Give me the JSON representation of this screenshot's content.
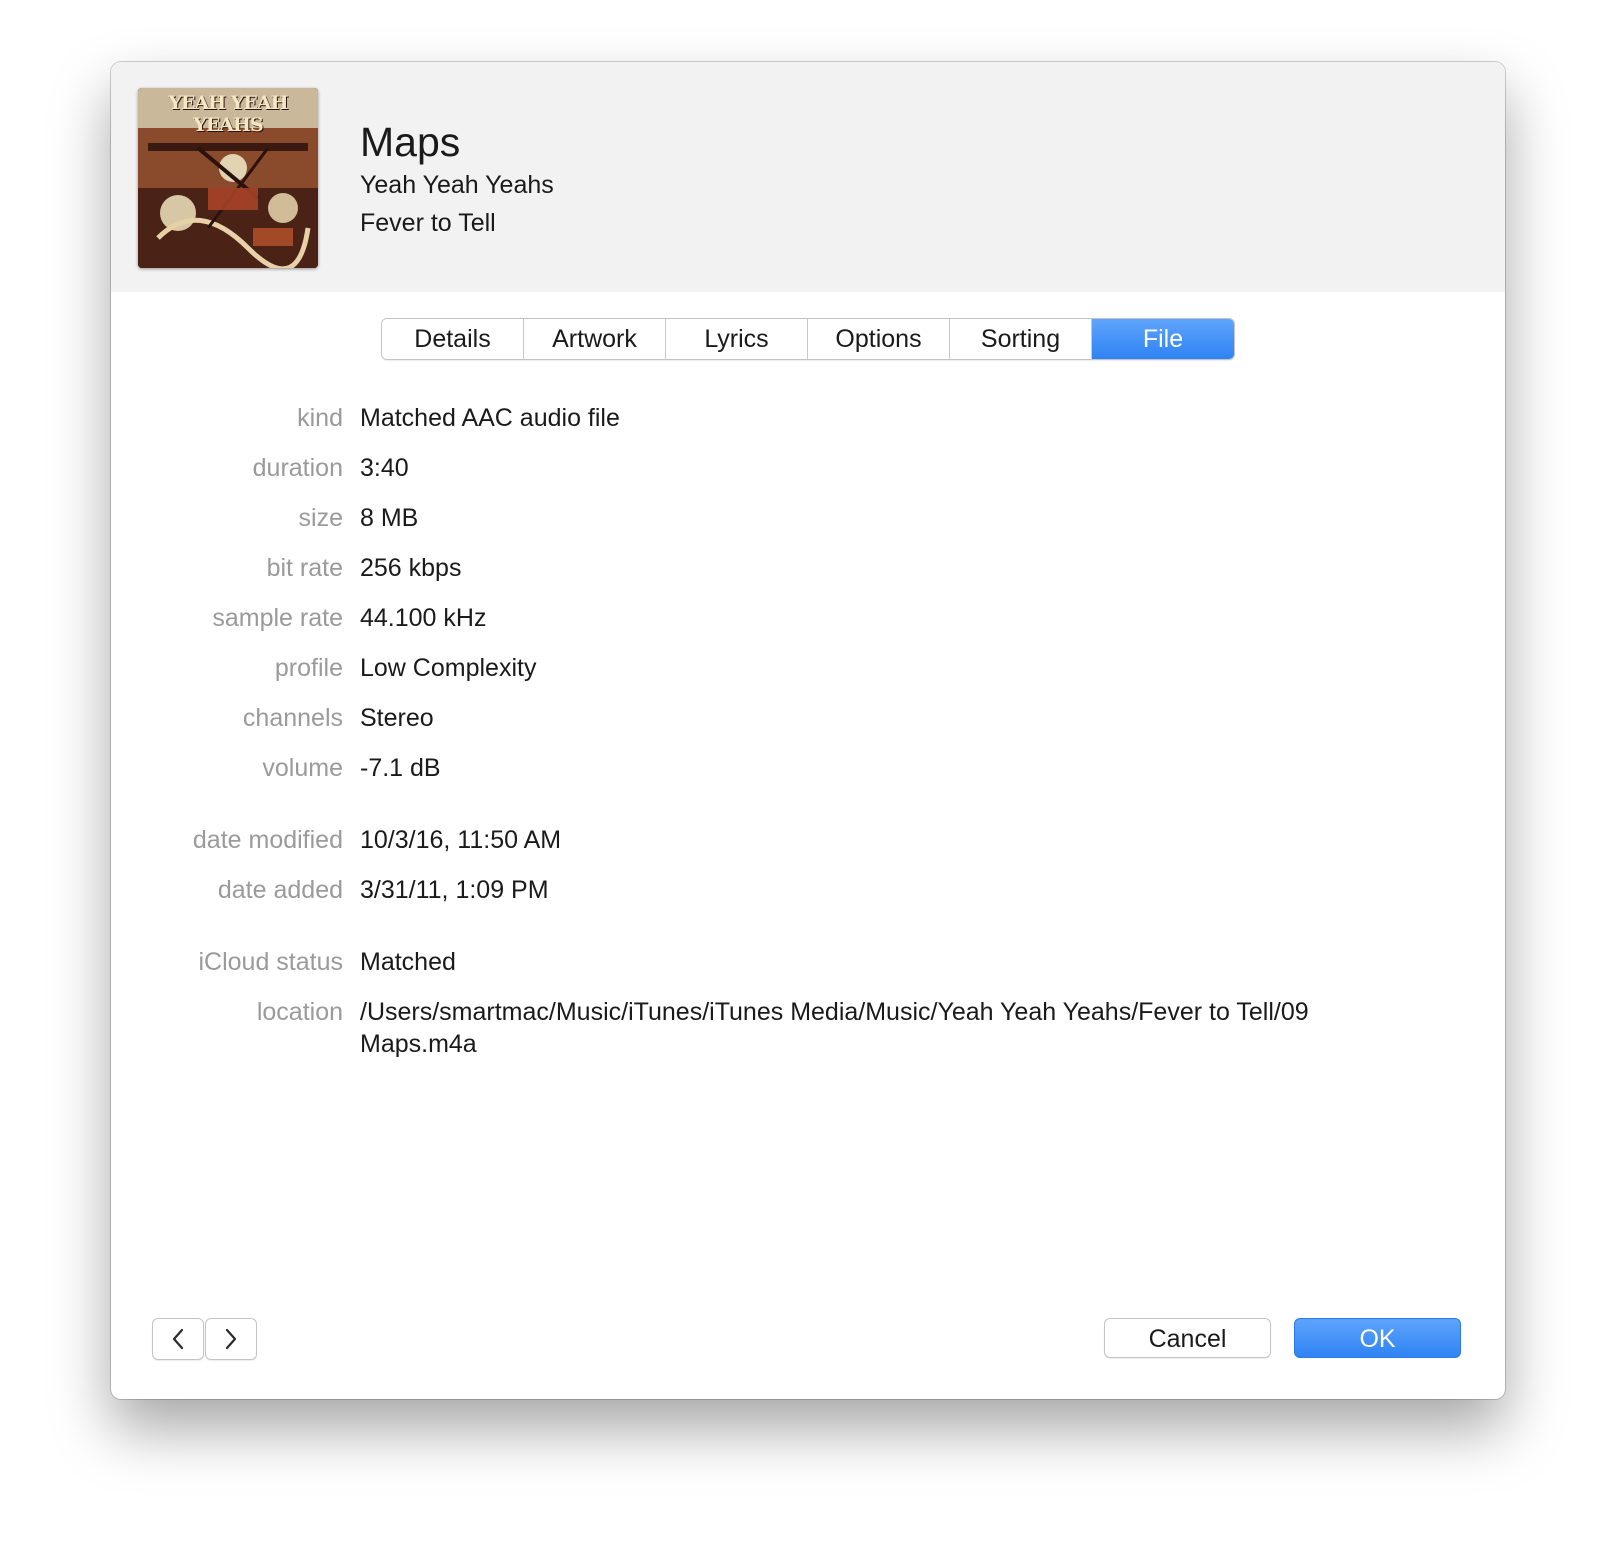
{
  "header": {
    "artwork_caption": "YEAH YEAH YEAHS",
    "song_title": "Maps",
    "artist": "Yeah Yeah Yeahs",
    "album": "Fever to Tell"
  },
  "tabs": [
    {
      "label": "Details",
      "active": false
    },
    {
      "label": "Artwork",
      "active": false
    },
    {
      "label": "Lyrics",
      "active": false
    },
    {
      "label": "Options",
      "active": false
    },
    {
      "label": "Sorting",
      "active": false
    },
    {
      "label": "File",
      "active": true
    }
  ],
  "file_info": {
    "kind": {
      "label": "kind",
      "value": "Matched AAC audio file"
    },
    "duration": {
      "label": "duration",
      "value": "3:40"
    },
    "size": {
      "label": "size",
      "value": "8 MB"
    },
    "bit_rate": {
      "label": "bit rate",
      "value": "256 kbps"
    },
    "sample_rate": {
      "label": "sample rate",
      "value": "44.100 kHz"
    },
    "profile": {
      "label": "profile",
      "value": "Low Complexity"
    },
    "channels": {
      "label": "channels",
      "value": "Stereo"
    },
    "volume": {
      "label": "volume",
      "value": "-7.1 dB"
    },
    "date_modified": {
      "label": "date modified",
      "value": "10/3/16, 11:50 AM"
    },
    "date_added": {
      "label": "date added",
      "value": "3/31/11, 1:09 PM"
    },
    "icloud_status": {
      "label": "iCloud status",
      "value": "Matched"
    },
    "location": {
      "label": "location",
      "value": "/Users/smartmac/Music/iTunes/iTunes Media/Music/Yeah Yeah Yeahs/Fever to Tell/09 Maps.m4a"
    }
  },
  "footer": {
    "prev_icon": "chevron-left-icon",
    "next_icon": "chevron-right-icon",
    "cancel_label": "Cancel",
    "ok_label": "OK"
  },
  "colors": {
    "accent": "#3b8df7",
    "header_bg": "#f2f2f2",
    "label_text": "#9a9a9a"
  }
}
